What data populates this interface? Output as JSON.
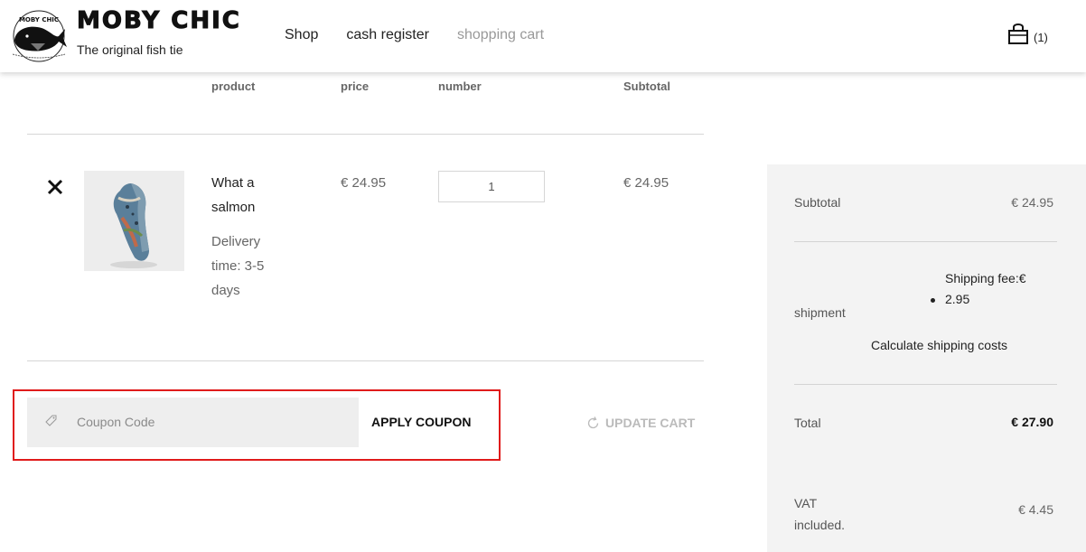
{
  "brand": {
    "logo_text": "MOBY CHIC",
    "name": "MOBY CHIC",
    "tagline": "The original fish tie"
  },
  "nav": {
    "items": [
      {
        "label": "Shop"
      },
      {
        "label": "cash register"
      },
      {
        "label": "shopping cart"
      }
    ]
  },
  "cart_badge": {
    "count": "(1)"
  },
  "table": {
    "headers": {
      "product": "product",
      "price": "price",
      "number": "number",
      "subtotal": "Subtotal"
    }
  },
  "item": {
    "name": "What a salmon",
    "delivery": "Delivery time: 3-5 days",
    "price": "€ 24.95",
    "quantity": "1",
    "subtotal": "€ 24.95"
  },
  "coupon": {
    "placeholder": "Coupon Code",
    "apply_label": "APPLY COUPON",
    "update_label": "UPDATE CART"
  },
  "totals": {
    "subtotal_label": "Subtotal",
    "subtotal_value": "€ 24.95",
    "shipment_label": "shipment",
    "shipping_title": "Shipping fee:€",
    "shipping_value": "2.95",
    "calc_label": "Calculate shipping costs",
    "total_label": "Total",
    "total_value": "€ 27.90",
    "vat_label": "VAT included.",
    "vat_value": "€ 4.45"
  },
  "colors": {
    "highlight": "#e01b1b",
    "muted_nav": "#999999",
    "sidebar_bg": "#f3f3f3",
    "coupon_bg": "#eeeeee"
  }
}
